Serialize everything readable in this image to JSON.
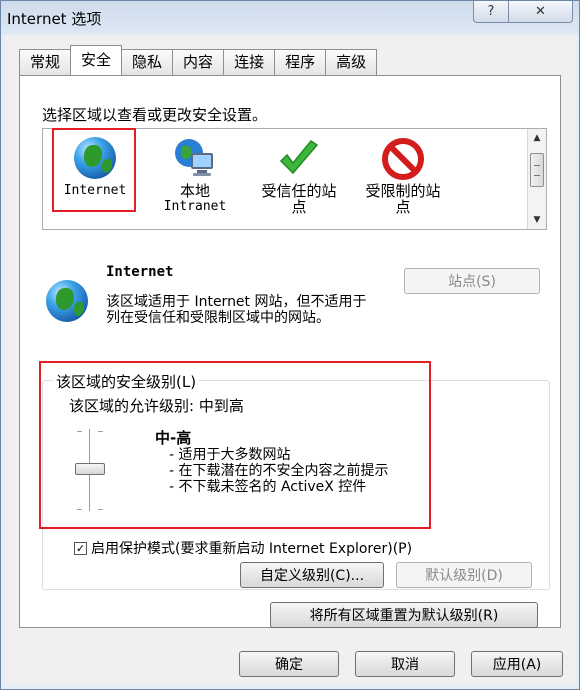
{
  "window": {
    "title": "Internet 选项",
    "help_label": "?",
    "close_label": "✕"
  },
  "tabs": [
    {
      "label": "常规"
    },
    {
      "label": "安全",
      "active": true
    },
    {
      "label": "隐私"
    },
    {
      "label": "内容"
    },
    {
      "label": "连接"
    },
    {
      "label": "程序"
    },
    {
      "label": "高级"
    }
  ],
  "security": {
    "select_zone_label": "选择区域以查看或更改安全设置。",
    "zones": [
      {
        "label": "Internet",
        "icon": "globe-icon",
        "selected": true
      },
      {
        "label": "本地",
        "sub": "Intranet",
        "icon": "local-intranet-icon"
      },
      {
        "label": "受信任的站",
        "sub": "点",
        "icon": "checkmark-icon"
      },
      {
        "label": "受限制的站",
        "sub": "点",
        "icon": "restricted-icon"
      }
    ],
    "zone_info_title": "Internet",
    "zone_info_desc": "该区域适用于 Internet 网站，但不适用于列在受信任和受限制区域中的网站。",
    "sites_button": "站点(S)",
    "level_group_title": "该区域的安全级别(L)",
    "allowed_levels": "该区域的允许级别: 中到高",
    "level_name": "中-高",
    "level_bullets": [
      "- 适用于大多数网站",
      "- 在下载潜在的不安全内容之前提示",
      "- 不下载未签名的 ActiveX 控件"
    ],
    "slider_level": 2,
    "slider_levels": 3,
    "protected_mode_label": "启用保护模式(要求重新启动 Internet Explorer)(P)",
    "protected_mode_checked": true,
    "custom_level_button": "自定义级别(C)...",
    "default_level_button": "默认级别(D)",
    "reset_all_button": "将所有区域重置为默认级别(R)"
  },
  "footer": {
    "ok": "确定",
    "cancel": "取消",
    "apply": "应用(A)"
  },
  "colors": {
    "highlight_border": "#e31e24"
  }
}
